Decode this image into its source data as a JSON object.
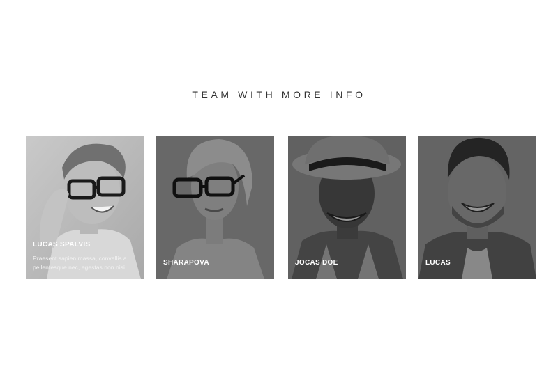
{
  "section": {
    "title": "TEAM WITH MORE INFO"
  },
  "team": [
    {
      "name": "LUCAS SPALVIS",
      "bio": "Praesent sapien massa, convallis a pellentesque nec, egestas non nisi."
    },
    {
      "name": "SHARAPOVA"
    },
    {
      "name": "JOCAS DOE"
    },
    {
      "name": "LUCAS"
    }
  ]
}
